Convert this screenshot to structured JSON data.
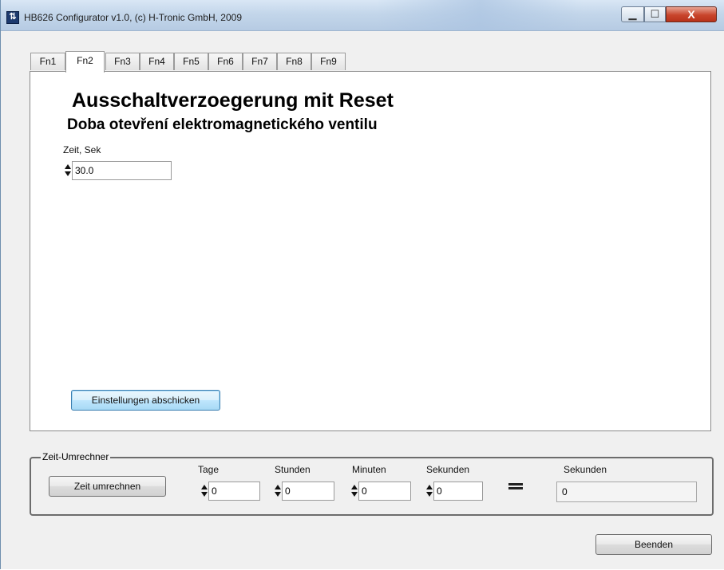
{
  "window": {
    "title": "HB626 Configurator v1.0, (c) H-Tronic GmbH, 2009",
    "controls": {
      "minimize": "▁",
      "maximize": "☐",
      "close": "X"
    }
  },
  "tabs": [
    {
      "label": "Fn1"
    },
    {
      "label": "Fn2",
      "active": true
    },
    {
      "label": "Fn3"
    },
    {
      "label": "Fn4"
    },
    {
      "label": "Fn5"
    },
    {
      "label": "Fn6"
    },
    {
      "label": "Fn7"
    },
    {
      "label": "Fn8"
    },
    {
      "label": "Fn9"
    }
  ],
  "panel": {
    "heading": "Ausschaltverzoegerung mit Reset",
    "subheading": "Doba otevření elektromagnetického ventilu",
    "time_label": "Zeit, Sek",
    "time_value": "30.0",
    "submit_label": "Einstellungen abschicken"
  },
  "converter": {
    "group_title": "Zeit-Umrechner",
    "convert_label": "Zeit umrechnen",
    "days_label": "Tage",
    "days_value": "0",
    "hours_label": "Stunden",
    "hours_value": "0",
    "minutes_label": "Minuten",
    "minutes_value": "0",
    "seconds_label": "Sekunden",
    "seconds_value": "0",
    "result_label": "Sekunden",
    "result_value": "0"
  },
  "footer": {
    "exit_label": "Beenden"
  },
  "colors": {
    "titlebar": "#c3d6ea",
    "close_button": "#c8452c",
    "panel": "#ffffff",
    "window_bg": "#f0f0f0"
  }
}
